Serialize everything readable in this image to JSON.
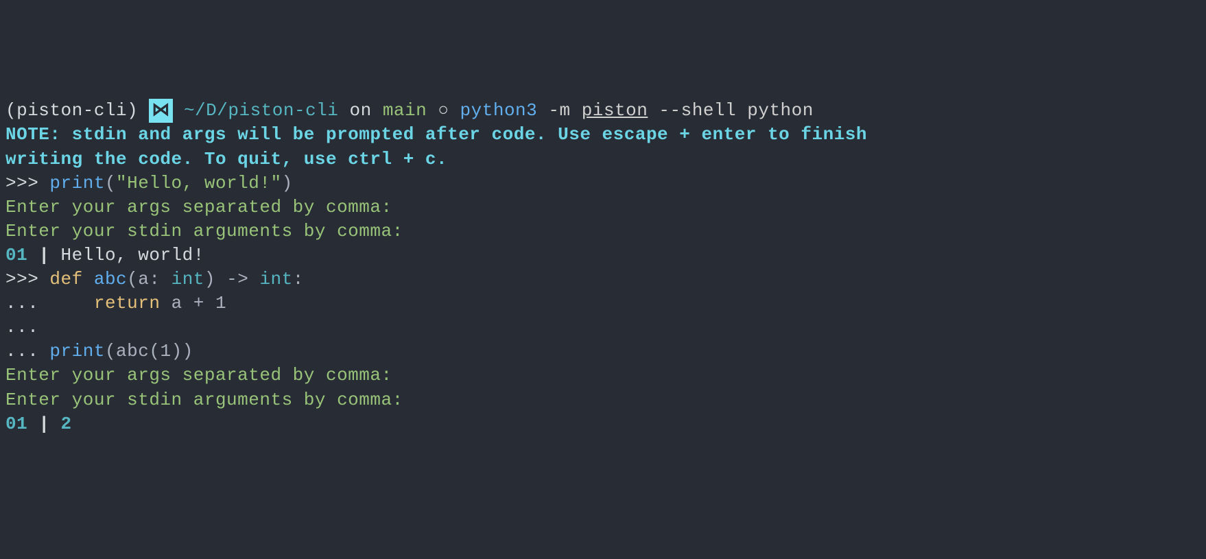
{
  "prompt": {
    "env": "(piston-cli)",
    "icon": "⋈",
    "path": "~/D/piston-cli",
    "on": " on ",
    "branch": "main",
    "sep": " ○ ",
    "cmd_prefix": "python3 ",
    "cmd_flag1": "-m ",
    "cmd_module": "piston",
    "cmd_flag2": " --shell ",
    "cmd_arg": "python"
  },
  "note": {
    "label": "NOTE:",
    "text1": " stdin and args will be prompted after code. Use escape + enter to finish",
    "text2": "writing the code. To quit, use ctrl + c."
  },
  "session": {
    "ps1": ">>> ",
    "ps2": "... ",
    "line1": {
      "fn": "print",
      "open": "(",
      "str": "\"Hello, world!\"",
      "close": ")"
    },
    "prompt_args": "Enter your args separated by comma:",
    "prompt_stdin": "Enter your stdin arguments by comma:",
    "out1": {
      "lineno": "01",
      "pipe": " | ",
      "text": "Hello, world!"
    },
    "line2": {
      "def": "def",
      "sp1": " ",
      "fn": "abc",
      "open": "(",
      "param": "a",
      "colon1": ": ",
      "type1": "int",
      "close": ")",
      "arrow": " -> ",
      "type2": "int",
      "colon2": ":"
    },
    "line3": {
      "indent": "    ",
      "ret": "return",
      "sp": " ",
      "var": "a",
      "op": " + ",
      "num": "1"
    },
    "line4_empty": "",
    "line5": {
      "fn": "print",
      "open": "(",
      "inner_fn": "abc",
      "inner_open": "(",
      "num": "1",
      "inner_close": ")",
      "close": ")"
    },
    "out2": {
      "lineno": "01",
      "pipe": " | ",
      "text": "2"
    }
  }
}
